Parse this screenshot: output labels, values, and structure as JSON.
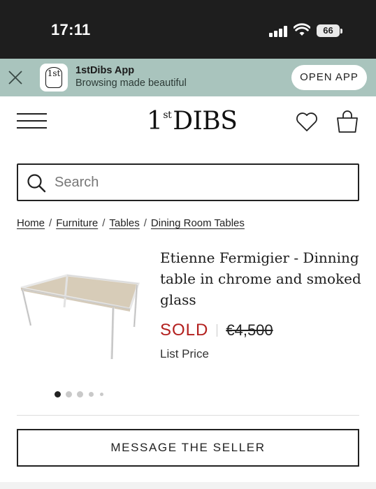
{
  "status_bar": {
    "time": "17:11",
    "battery": "66"
  },
  "app_banner": {
    "logo_text": "1st",
    "app_name": "1stDibs App",
    "tagline": "Browsing made beautiful",
    "open_label": "OPEN APP"
  },
  "header": {
    "logo_main": "1",
    "logo_sup": "st",
    "logo_word": "DIBS"
  },
  "search": {
    "placeholder": "Search"
  },
  "breadcrumb": {
    "items": [
      "Home",
      "Furniture",
      "Tables",
      "Dining Room Tables"
    ],
    "separator": "/"
  },
  "product": {
    "title": "Etienne Fermigier - Dinning table in chrome and smoked glass",
    "status": "SOLD",
    "price": "€4,500",
    "price_label": "List Price",
    "image_count": 5,
    "active_image": 1
  },
  "actions": {
    "message_label": "MESSAGE THE SELLER"
  },
  "colors": {
    "status_bar": "#1e1e1e",
    "banner": "#a9c4bd",
    "sold": "#b3201e"
  },
  "icons": [
    "close-icon",
    "menu-icon",
    "heart-icon",
    "shopping-bag-icon",
    "search-icon",
    "wifi-icon",
    "signal-icon",
    "battery-icon"
  ]
}
